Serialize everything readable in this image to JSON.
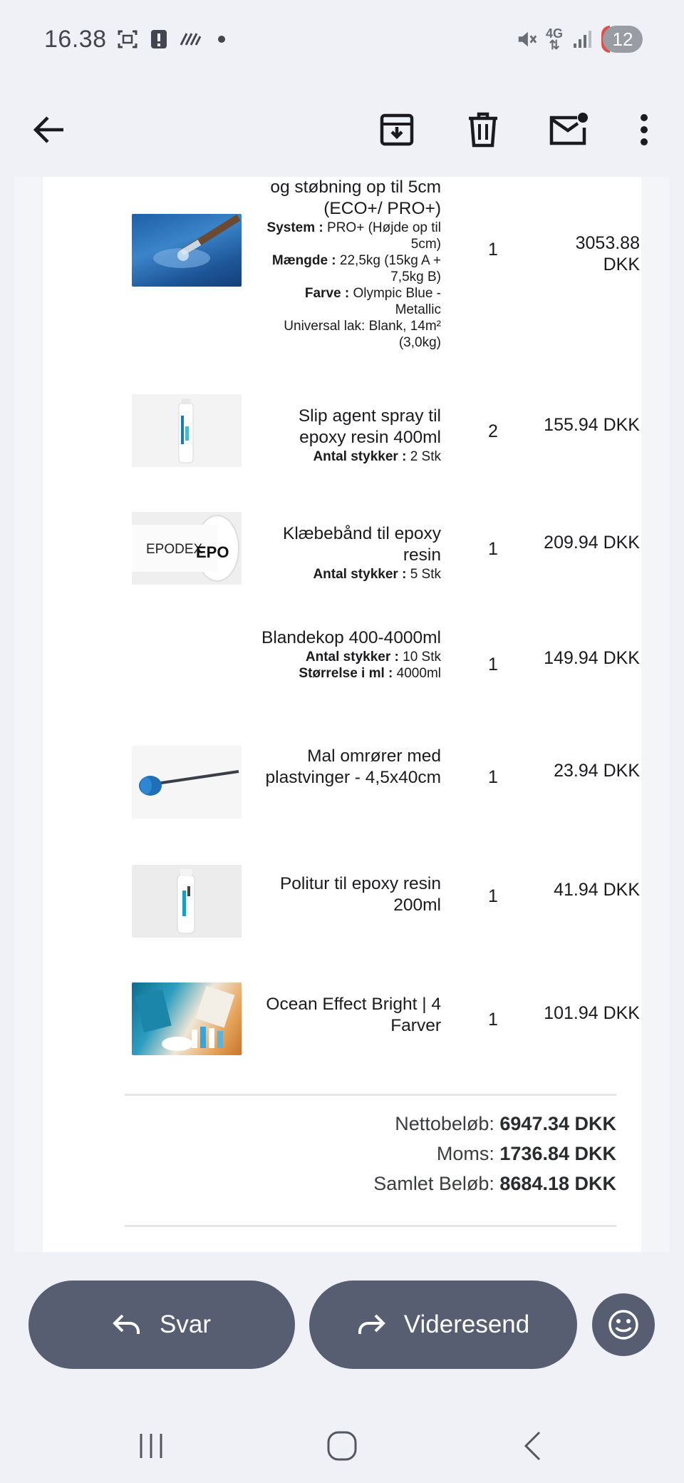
{
  "status": {
    "time": "16.38",
    "network": "4G",
    "notification_count": "12"
  },
  "toolbar": {
    "back_icon": "arrow-left-icon",
    "archive_icon": "archive-icon",
    "delete_icon": "trash-icon",
    "unread_icon": "mark-unread-icon",
    "more_icon": "more-vert-icon"
  },
  "order": {
    "items": [
      {
        "name": "og støbning op til 5cm (ECO+/ PRO+)",
        "meta": [
          {
            "key": "System :",
            "value": "PRO+ (Højde op til 5cm)"
          },
          {
            "key": "Mængde :",
            "value": "22,5kg (15kg A + 7,5kg B)"
          },
          {
            "key": "Farve :",
            "value": "Olympic Blue - Metallic"
          },
          {
            "key": "",
            "value": "Universal lak: Blank, 14m² (3,0kg)"
          }
        ],
        "qty": "1",
        "price": "3053.88 DKK",
        "image": "epoxy-blue-product-image"
      },
      {
        "name": "Slip agent spray til epoxy resin 400ml",
        "meta": [
          {
            "key": "Antal stykker :",
            "value": "2 Stk"
          }
        ],
        "qty": "2",
        "price": "155.94 DKK",
        "image": "spray-can-image"
      },
      {
        "name": "Klæbebånd til epoxy resin",
        "meta": [
          {
            "key": "Antal stykker :",
            "value": "5 Stk"
          }
        ],
        "qty": "1",
        "price": "209.94 DKK",
        "image": "tape-roll-image",
        "image_text": "EPODEX"
      },
      {
        "name": "Blandekop 400-4000ml",
        "meta": [
          {
            "key": "Antal stykker :",
            "value": "10 Stk"
          },
          {
            "key": "Størrelse i ml :",
            "value": "4000ml"
          }
        ],
        "qty": "1",
        "price": "149.94 DKK",
        "image": ""
      },
      {
        "name": "Mal omrører med plastvinger - 4,5x40cm",
        "meta": [],
        "qty": "1",
        "price": "23.94 DKK",
        "image": "mixer-paddle-image"
      },
      {
        "name": "Politur til epoxy resin 200ml",
        "meta": [],
        "qty": "1",
        "price": "41.94 DKK",
        "image": "polish-bottle-image"
      },
      {
        "name": "Ocean Effect Bright | 4 Farver",
        "meta": [],
        "qty": "1",
        "price": "101.94 DKK",
        "image": "ocean-effect-image"
      }
    ],
    "totals": {
      "net_label": "Nettobeløb:",
      "net_value": "6947.34 DKK",
      "vat_label": "Moms:",
      "vat_value": "1736.84 DKK",
      "total_label": "Samlet Beløb:",
      "total_value": "8684.18 DKK"
    }
  },
  "actions": {
    "reply_label": "Svar",
    "forward_label": "Videresend",
    "emoji_icon": "emoji-icon"
  },
  "colors": {
    "action_button": "#575e72",
    "background": "#f0f1f7",
    "accent_red": "#e0504a"
  }
}
